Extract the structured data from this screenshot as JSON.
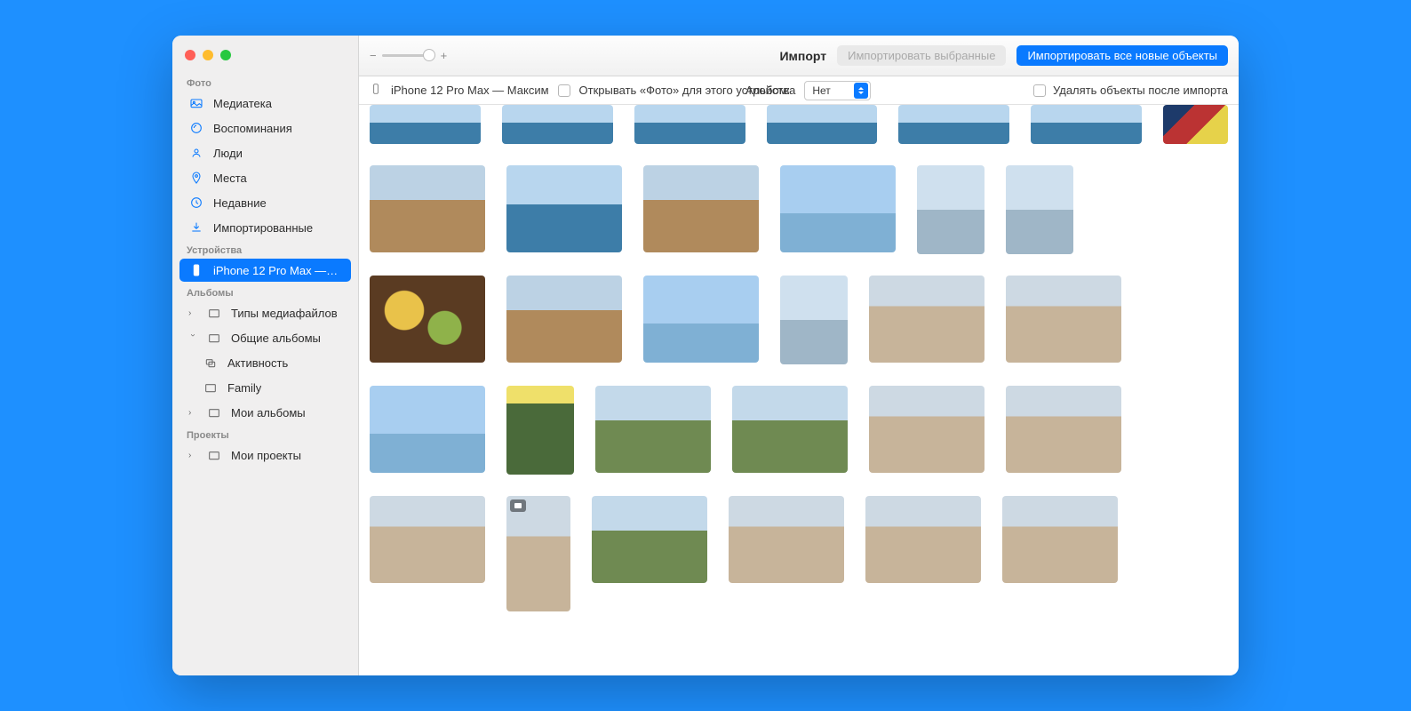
{
  "toolbar": {
    "title": "Импорт",
    "import_selected": "Импортировать выбранные",
    "import_all_new": "Импортировать все новые объекты"
  },
  "subbar": {
    "device_name": "iPhone 12 Pro Max — Максим",
    "open_photos_label": "Открывать «Фото» для этого устройства",
    "album_label": "Альбом:",
    "album_value": "Нет",
    "delete_after_label": "Удалять объекты после импорта"
  },
  "sidebar": {
    "sections": {
      "photo": "Фото",
      "devices": "Устройства",
      "albums": "Альбомы",
      "projects": "Проекты"
    },
    "photo_items": {
      "library": "Медиатека",
      "memories": "Воспоминания",
      "people": "Люди",
      "places": "Места",
      "recent": "Недавние",
      "imported": "Импортированные"
    },
    "device_item": "iPhone 12 Pro Max —…",
    "album_items": {
      "media_types": "Типы медиафайлов",
      "shared_albums": "Общие альбомы",
      "activity": "Активность",
      "family": "Family",
      "my_albums": "Мои альбомы"
    },
    "project_items": {
      "my_projects": "Мои проекты"
    }
  }
}
